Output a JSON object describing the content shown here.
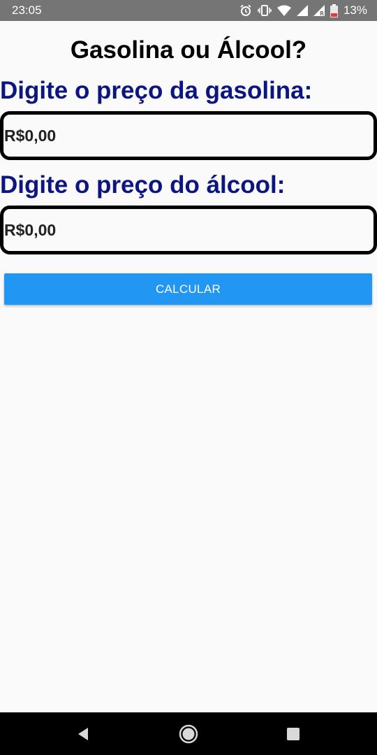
{
  "status_bar": {
    "time": "23:05",
    "battery": "13%",
    "icons": [
      "alarm-icon",
      "vibrate-icon",
      "wifi-icon",
      "signal-icon",
      "signal-r-icon",
      "battery-low-icon"
    ]
  },
  "app": {
    "title": "Gasolina ou Álcool?",
    "gasoline": {
      "label": "Digite o preço da gasolina:",
      "placeholder": "R$0,00"
    },
    "alcohol": {
      "label": "Digite o preço do álcool:",
      "placeholder": "R$0,00"
    },
    "calculate_button": "CALCULAR"
  },
  "nav_bar": {
    "icons": [
      "back-icon",
      "home-icon",
      "recents-icon"
    ]
  },
  "colors": {
    "status_bar": "#757575",
    "label": "#0d1680",
    "button": "#2196f3",
    "background": "#fafafa"
  }
}
